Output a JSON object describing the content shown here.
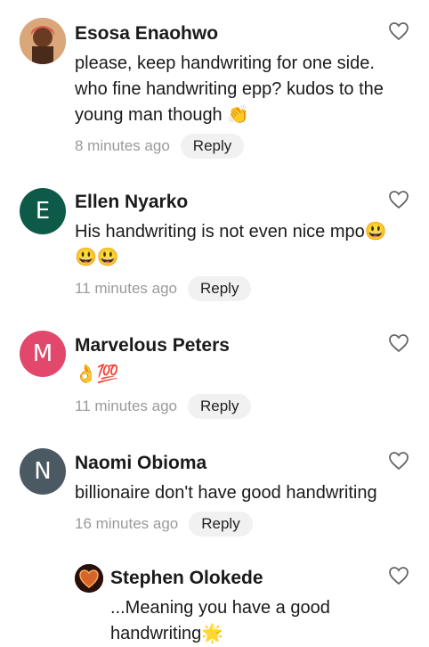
{
  "comments": [
    {
      "name": "Esosa Enaohwo",
      "text": "please, keep handwriting for one side. who fine handwriting epp? kudos to the young man though 👏",
      "time": "8 minutes ago",
      "reply": "Reply",
      "avatar_initial": "",
      "avatar_color": "#c07a4a"
    },
    {
      "name": "Ellen Nyarko",
      "text": "His handwriting is not even nice mpo😃😃😃",
      "time": "11 minutes ago",
      "reply": "Reply",
      "avatar_initial": "E",
      "avatar_color": "#0d5a48"
    },
    {
      "name": "Marvelous Peters",
      "text": "👌💯",
      "time": "11 minutes ago",
      "reply": "Reply",
      "avatar_initial": "M",
      "avatar_color": "#e2476c"
    },
    {
      "name": "Naomi Obioma",
      "text": "billionaire don't have good handwriting",
      "time": "16 minutes ago",
      "reply": "Reply",
      "avatar_initial": "N",
      "avatar_color": "#4b5963"
    },
    {
      "name": "Stephen Olokede",
      "text": "...Meaning you have a good handwriting🌟",
      "avatar_initial": "",
      "avatar_color": "#3a1a12"
    }
  ]
}
